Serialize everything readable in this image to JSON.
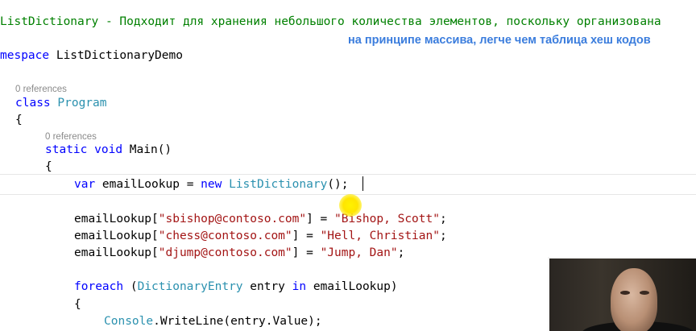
{
  "code": {
    "comment_line": "ListDictionary - Подходит для хранения небольшого количества элементов, поскольку организована",
    "namespace_keyword": "mespace",
    "namespace_name": " ListDictionaryDemo",
    "references_class": "0 references",
    "class_keyword": "class",
    "class_name": "Program",
    "open_brace": "{",
    "references_main": "0 references",
    "static_keyword": "static",
    "void_keyword": "void",
    "main_signature": " Main()",
    "var_keyword": "var",
    "var_decl": " emailLookup = ",
    "new_keyword": "new",
    "list_dictionary_type": "ListDictionary",
    "ctor_end": "();",
    "entries": [
      {
        "prefix": "emailLookup[",
        "key": "\"sbishop@contoso.com\"",
        "mid": "] = ",
        "value": "\"Bishop, Scott\"",
        "end": ";"
      },
      {
        "prefix": "emailLookup[",
        "key": "\"chess@contoso.com\"",
        "mid": "] = ",
        "value": "\"Hell, Christian\"",
        "end": ";"
      },
      {
        "prefix": "emailLookup[",
        "key": "\"djump@contoso.com\"",
        "mid": "] = ",
        "value": "\"Jump, Dan\"",
        "end": ";"
      }
    ],
    "foreach_keyword": "foreach",
    "foreach_open": " (",
    "dictionary_entry_type": "DictionaryEntry",
    "foreach_entry": " entry ",
    "in_keyword": "in",
    "foreach_close": " emailLookup)",
    "console_type": "Console",
    "console_call": ".WriteLine(entry.Value);"
  },
  "overlay_caption": "на принципе массива, легче чем таблица хеш кодов",
  "colors": {
    "keyword": "#0000ff",
    "type": "#2b91af",
    "string": "#a31515",
    "comment": "#008000",
    "caption": "#3b7ddd",
    "cursor_highlight": "#fff200"
  }
}
